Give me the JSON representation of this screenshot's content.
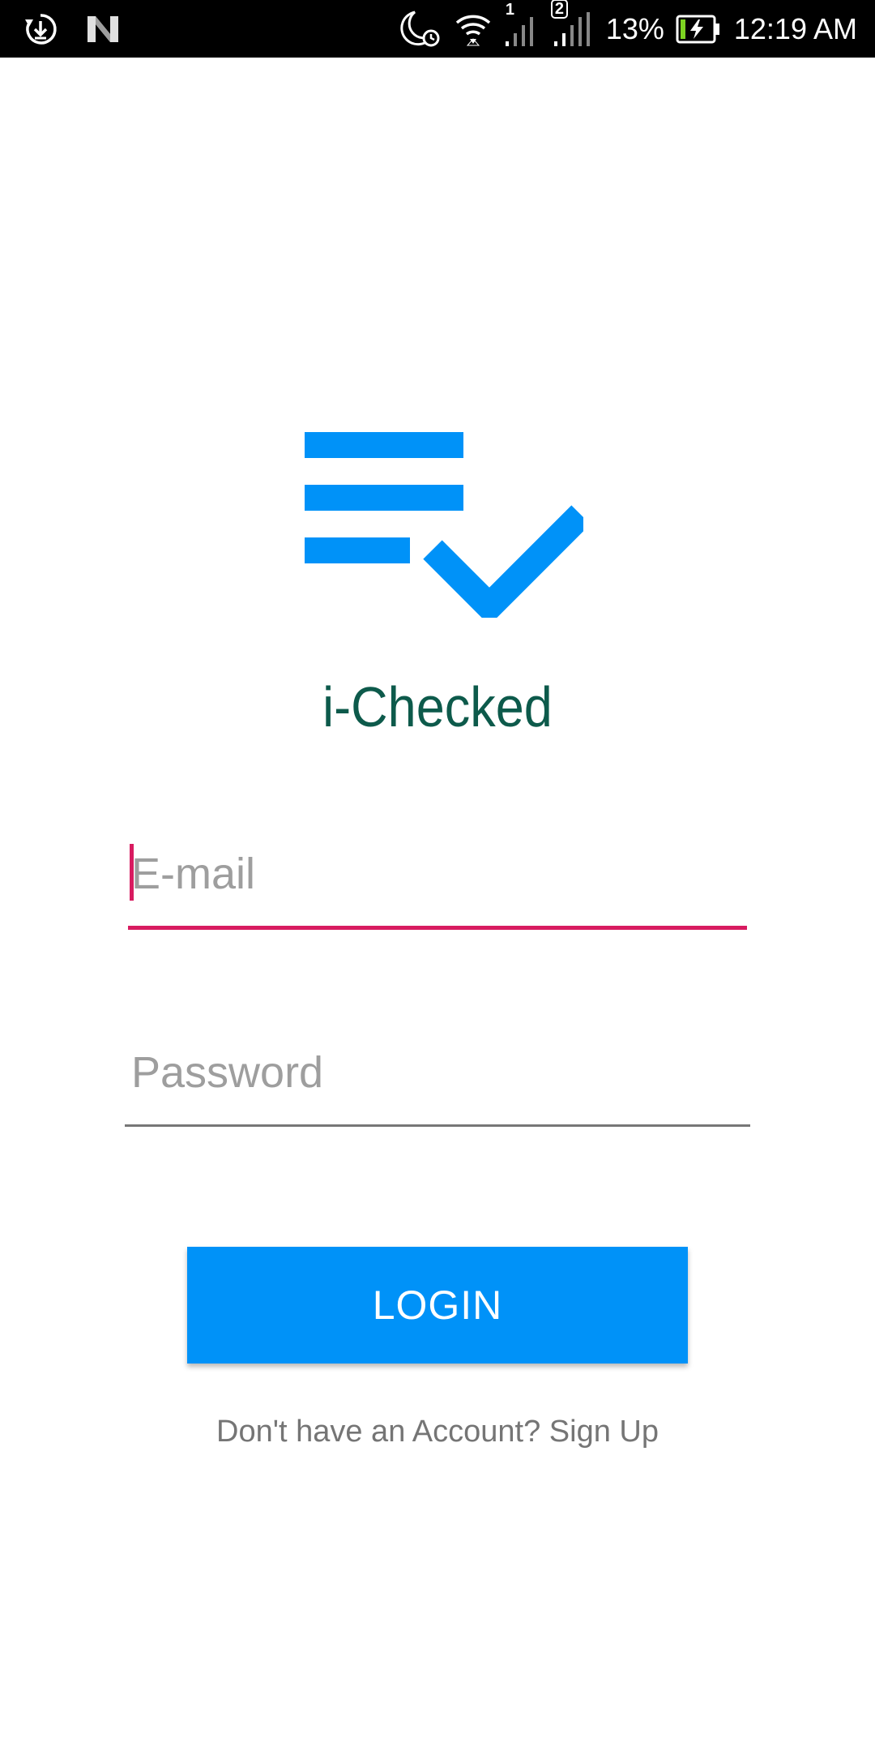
{
  "status_bar": {
    "icons_left": [
      "download-sync-icon",
      "notification-n-icon"
    ],
    "icons_right": [
      "night-alarm-icon",
      "wifi-icon",
      "signal-sim1-icon",
      "signal-sim2-icon",
      "battery-charging-icon"
    ],
    "sim1_label": "1",
    "sim2_label": "2",
    "battery_percent": "13%",
    "time": "12:19 AM"
  },
  "app": {
    "logo_icon": "checklist-icon",
    "name": "i-Checked",
    "brand_color": "#0092f8",
    "name_color": "#0d5a4b"
  },
  "form": {
    "email": {
      "placeholder": "E-mail",
      "value": "",
      "focused": true,
      "accent_color": "#d81b60"
    },
    "password": {
      "placeholder": "Password",
      "value": ""
    },
    "login_label": "LOGIN",
    "signup_text": "Don't have an Account? Sign Up"
  }
}
